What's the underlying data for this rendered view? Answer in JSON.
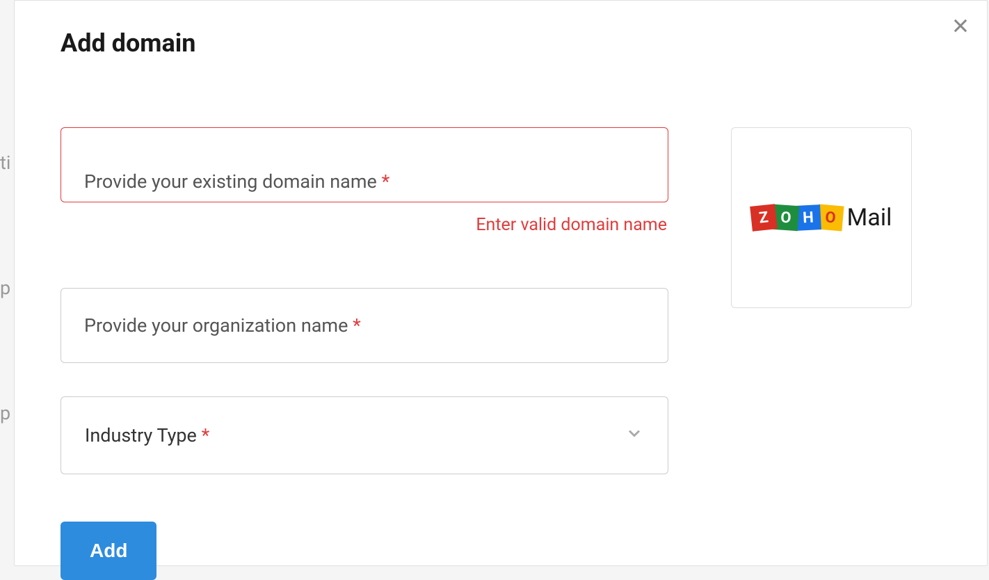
{
  "modal": {
    "title": "Add domain"
  },
  "form": {
    "domain": {
      "placeholder": "Provide your existing domain name",
      "required_marker": "*",
      "error": "Enter valid domain name"
    },
    "organization": {
      "placeholder": "Provide your organization name",
      "required_marker": "*"
    },
    "industry": {
      "label": "Industry Type",
      "required_marker": "*"
    }
  },
  "buttons": {
    "add": "Add"
  },
  "logo": {
    "letters": [
      "Z",
      "O",
      "H",
      "O"
    ],
    "suffix": "Mail"
  },
  "colors": {
    "error": "#e03c3c",
    "primary": "#2d8cde",
    "border": "#cccccc"
  }
}
